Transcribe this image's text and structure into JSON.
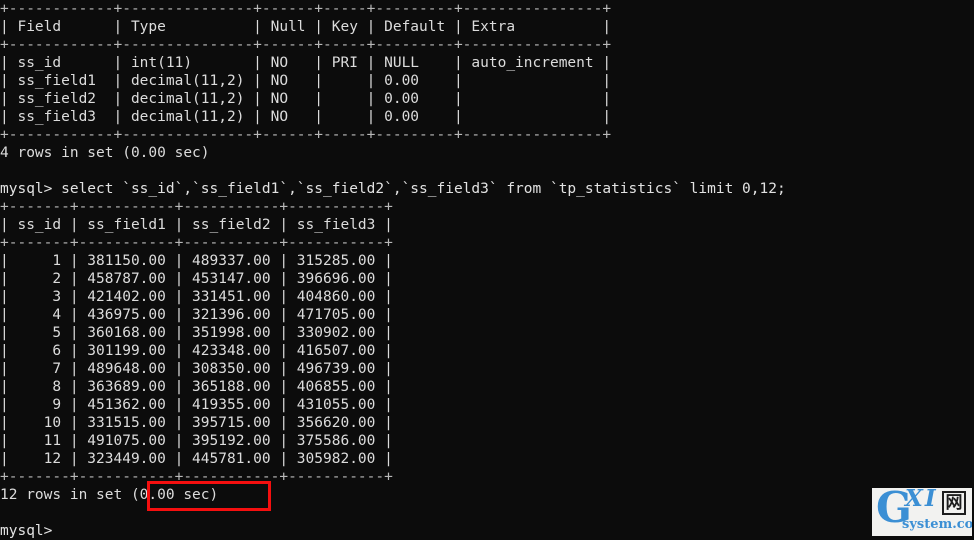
{
  "terminal": {
    "background_color": "#0c0c0c",
    "text_color": "#d6d6d6",
    "prompt": "mysql>",
    "lines": [
      "+------------+---------------+------+-----+---------+----------------+",
      "| Field      | Type          | Null | Key | Default | Extra          |",
      "+------------+---------------+------+-----+---------+----------------+",
      "| ss_id      | int(11)       | NO   | PRI | NULL    | auto_increment |",
      "| ss_field1  | decimal(11,2) | NO   |     | 0.00    |                |",
      "| ss_field2  | decimal(11,2) | NO   |     | 0.00    |                |",
      "| ss_field3  | decimal(11,2) | NO   |     | 0.00    |                |",
      "+------------+---------------+------+-----+---------+----------------+",
      "4 rows in set (0.00 sec)",
      "",
      "mysql> select `ss_id`,`ss_field1`,`ss_field2`,`ss_field3` from `tp_statistics` limit 0,12;",
      "+-------+-----------+-----------+-----------+",
      "| ss_id | ss_field1 | ss_field2 | ss_field3 |",
      "+-------+-----------+-----------+-----------+",
      "|     1 | 381150.00 | 489337.00 | 315285.00 |",
      "|     2 | 458787.00 | 453147.00 | 396696.00 |",
      "|     3 | 421402.00 | 331451.00 | 404860.00 |",
      "|     4 | 436975.00 | 321396.00 | 471705.00 |",
      "|     5 | 360168.00 | 351998.00 | 330902.00 |",
      "|     6 | 301199.00 | 423348.00 | 416507.00 |",
      "|     7 | 489648.00 | 308350.00 | 496739.00 |",
      "|     8 | 363689.00 | 365188.00 | 406855.00 |",
      "|     9 | 451362.00 | 419355.00 | 431055.00 |",
      "|    10 | 331515.00 | 395715.00 | 356620.00 |",
      "|    11 | 491075.00 | 395192.00 | 375586.00 |",
      "|    12 | 323449.00 | 445781.00 | 305982.00 |",
      "+-------+-----------+-----------+-----------+",
      "12 rows in set (0.00 sec)",
      "",
      "mysql>"
    ]
  },
  "describe_table": {
    "type": "table",
    "columns": [
      "Field",
      "Type",
      "Null",
      "Key",
      "Default",
      "Extra"
    ],
    "rows": [
      [
        "ss_id",
        "int(11)",
        "NO",
        "PRI",
        "NULL",
        "auto_increment"
      ],
      [
        "ss_field1",
        "decimal(11,2)",
        "NO",
        "",
        "0.00",
        ""
      ],
      [
        "ss_field2",
        "decimal(11,2)",
        "NO",
        "",
        "0.00",
        ""
      ],
      [
        "ss_field3",
        "decimal(11,2)",
        "NO",
        "",
        "0.00",
        ""
      ]
    ],
    "result_status": "4 rows in set (0.00 sec)"
  },
  "query": {
    "prompt": "mysql>",
    "sql": "select `ss_id`,`ss_field1`,`ss_field2`,`ss_field3` from `tp_statistics` limit 0,12;",
    "table_name": "tp_statistics",
    "limit": "0,12"
  },
  "result_table": {
    "type": "table",
    "columns": [
      "ss_id",
      "ss_field1",
      "ss_field2",
      "ss_field3"
    ],
    "rows": [
      [
        "1",
        "381150.00",
        "489337.00",
        "315285.00"
      ],
      [
        "2",
        "458787.00",
        "453147.00",
        "396696.00"
      ],
      [
        "3",
        "421402.00",
        "331451.00",
        "404860.00"
      ],
      [
        "4",
        "436975.00",
        "321396.00",
        "471705.00"
      ],
      [
        "5",
        "360168.00",
        "351998.00",
        "330902.00"
      ],
      [
        "6",
        "301199.00",
        "423348.00",
        "416507.00"
      ],
      [
        "7",
        "489648.00",
        "308350.00",
        "496739.00"
      ],
      [
        "8",
        "363689.00",
        "365188.00",
        "406855.00"
      ],
      [
        "9",
        "451362.00",
        "419355.00",
        "431055.00"
      ],
      [
        "10",
        "331515.00",
        "395715.00",
        "356620.00"
      ],
      [
        "11",
        "491075.00",
        "395192.00",
        "375586.00"
      ],
      [
        "12",
        "323449.00",
        "445781.00",
        "305982.00"
      ]
    ],
    "result_status": "12 rows in set (0.00 sec)",
    "highlighted_text": "(0.00 sec)"
  },
  "annotation": {
    "color": "#f50f0f",
    "target_text": "(0.00 sec)"
  },
  "watermark": {
    "letter_g": "G",
    "letters_xi": "XI",
    "cjk_char": "网",
    "domain": "system.com",
    "brand_color": "#3b8fd4",
    "background_color": "#f2f2f0"
  }
}
